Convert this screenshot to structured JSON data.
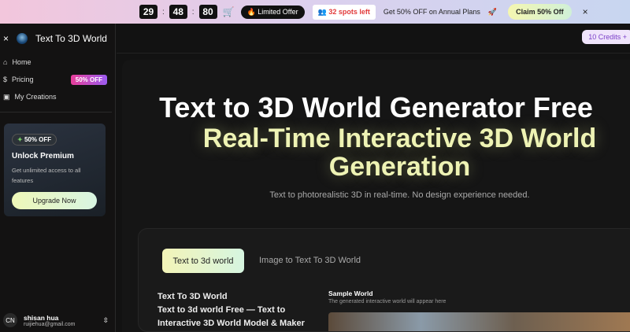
{
  "banner": {
    "hours": "29",
    "minutes": "48",
    "seconds": "80",
    "limited": "Limited Offer",
    "spots": "32 spots left",
    "promo": "Get 50% OFF on Annual Plans",
    "claim": "Claim 50% Off",
    "close": "×"
  },
  "sidebar": {
    "title": "Text To 3D World",
    "close": "×",
    "items": [
      {
        "label": "Home"
      },
      {
        "label": "Pricing",
        "badge": "50% OFF"
      },
      {
        "label": "My Creations"
      }
    ],
    "promo": {
      "tag": "50% OFF",
      "title": "Unlock Premium",
      "desc": "Get unlimited access to all features",
      "button": "Upgrade Now"
    },
    "user": {
      "initials": "CN",
      "name": "shisan hua",
      "email": "ruijiehua@gmail.com"
    }
  },
  "topbar": {
    "credits": "10 Credits  +"
  },
  "hero": {
    "title": "Text to 3D World Generator Free",
    "subtitle": "Real-Time Interactive 3D World Generation",
    "desc": "Text to photorealistic 3D in real-time. No design experience needed."
  },
  "card": {
    "tabs": [
      "Text to 3d world",
      "Image to Text To 3D World"
    ],
    "left_title": "Text To 3D World",
    "left_sub": "Text to 3d world Free — Text to Interactive 3D World Model & Maker",
    "sample_title": "Sample World",
    "sample_desc": "The generated interactive world will appear here"
  }
}
